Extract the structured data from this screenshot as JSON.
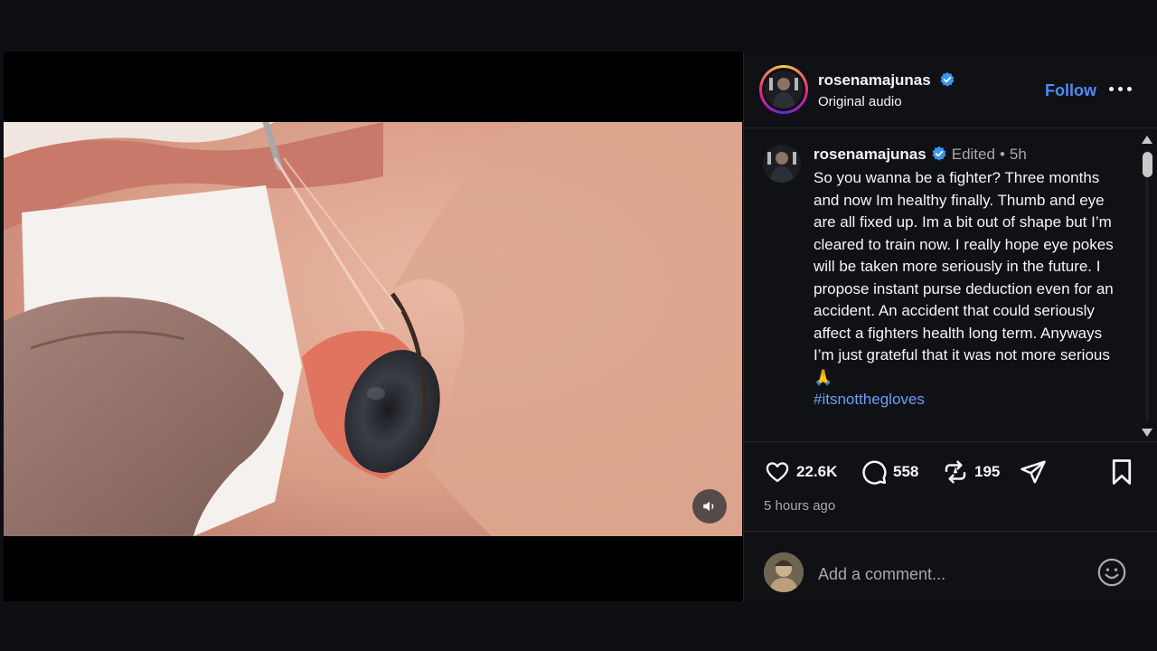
{
  "post": {
    "author": {
      "username": "rosenamajunas",
      "verified": true
    },
    "audio_label": "Original audio",
    "follow_label": "Follow",
    "caption": {
      "username": "rosenamajunas",
      "edited_label": "Edited",
      "separator": "•",
      "age": "5h",
      "text": "So you wanna be a fighter? Three months and now Im healthy finally. Thumb and eye are all fixed up. Im a bit out of shape but I’m cleared to train now. I really hope eye pokes will be taken more seriously in the future. I propose instant purse deduction even for an accident. An accident that could seriously affect a fighters health long term.  Anyways I’m just grateful that it was not more serious 🙏",
      "hashtag": "#itsnotthegloves"
    },
    "stats": {
      "likes": "22.6K",
      "comments": "558",
      "reposts": "195"
    },
    "timestamp": "5 hours ago",
    "comment_input": {
      "placeholder": "Add a comment..."
    }
  },
  "icons": {
    "verified": "verified-badge-icon",
    "like": "heart-icon",
    "comment": "comment-icon",
    "repost": "repost-icon",
    "share": "share-icon",
    "save": "bookmark-icon",
    "more": "more-horizontal-icon",
    "mute": "volume-icon",
    "emoji": "emoji-icon"
  },
  "colors": {
    "accent_blue": "#4c8df6",
    "hashtag": "#6d9cf8",
    "verified": "#3897f0",
    "background": "#0f1115"
  }
}
